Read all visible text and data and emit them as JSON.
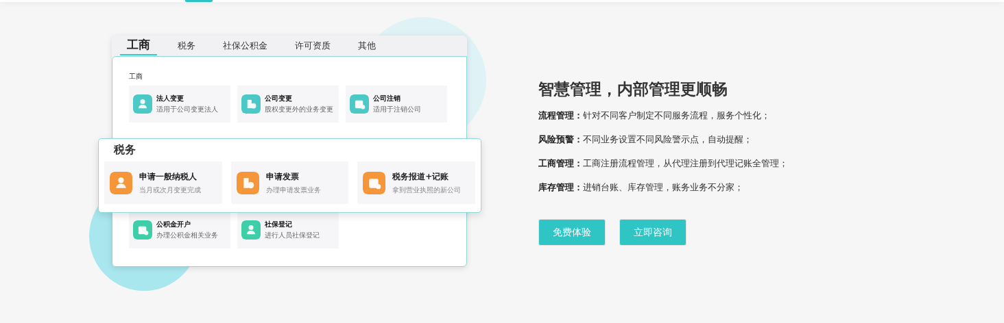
{
  "mockup": {
    "tabs": [
      {
        "label": "工商",
        "selected": true
      },
      {
        "label": "税务",
        "selected": false
      },
      {
        "label": "社保公积金",
        "selected": false
      },
      {
        "label": "许可资质",
        "selected": false
      },
      {
        "label": "其他",
        "selected": false
      }
    ],
    "section": {
      "title": "工商",
      "color": "#4cc9c6",
      "items": [
        {
          "title": "法人变更",
          "subtitle": "适用于公司变更法人"
        },
        {
          "title": "公司变更",
          "subtitle": "股权变更外的业务变更"
        },
        {
          "title": "公司注销",
          "subtitle": "适用于注销公司"
        }
      ]
    },
    "lower_items": {
      "color": "#3fcfa8",
      "items": [
        {
          "title": "公积金开户",
          "subtitle": "办理公积金相关业务"
        },
        {
          "title": "社保登记",
          "subtitle": "进行人员社保登记"
        }
      ]
    },
    "overlay": {
      "title": "税务",
      "color": "#f5963a",
      "items": [
        {
          "title": "申请一般纳税人",
          "subtitle": "当月或次月变更完成"
        },
        {
          "title": "申请发票",
          "subtitle": "办理申请发票业务"
        },
        {
          "title": "税务报道+记账",
          "subtitle": "拿到营业执照的新公司"
        }
      ]
    }
  },
  "heading": "智慧管理，内部管理更顺畅",
  "features": [
    {
      "label": "流程管理：",
      "text": "针对不同客户制定不同服务流程，服务个性化；"
    },
    {
      "label": "风险预警：",
      "text": "不同业务设置不同风险警示点，自动提醒；"
    },
    {
      "label": "工商管理：",
      "text": "工商注册流程管理，从代理注册到代理记账全管理；"
    },
    {
      "label": "库存管理：",
      "text": "进销台账、库存管理，账务业务不分家；"
    }
  ],
  "buttons": [
    "免费体验",
    "立即咨询"
  ]
}
